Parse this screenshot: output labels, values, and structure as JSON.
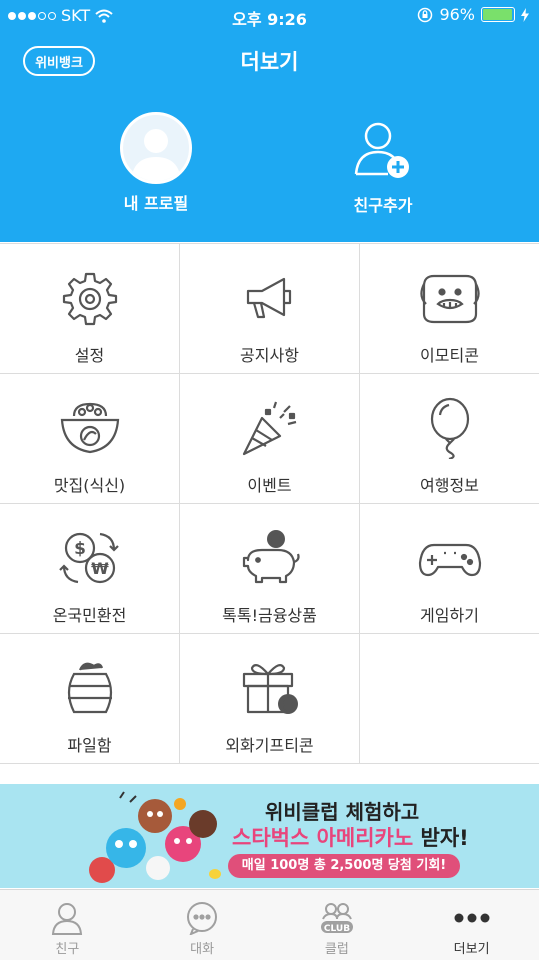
{
  "status": {
    "carrier": "SKT",
    "time": "오후 9:26",
    "battery": "96%",
    "battery_level": 0.96
  },
  "header": {
    "brand": "위비뱅크",
    "title": "더보기",
    "profile_label": "내 프로필",
    "add_friend_label": "친구추가"
  },
  "menu": [
    {
      "label": "설정",
      "icon": "gear-icon"
    },
    {
      "label": "공지사항",
      "icon": "megaphone-icon"
    },
    {
      "label": "이모티콘",
      "icon": "dog-face-icon"
    },
    {
      "label": "맛집(식신)",
      "icon": "bowl-icon"
    },
    {
      "label": "이벤트",
      "icon": "party-popper-icon"
    },
    {
      "label": "여행정보",
      "icon": "balloon-icon"
    },
    {
      "label": "온국민환전",
      "icon": "currency-exchange-icon"
    },
    {
      "label": "톡톡!금융상품",
      "icon": "piggy-bank-icon"
    },
    {
      "label": "게임하기",
      "icon": "gamepad-icon"
    },
    {
      "label": "파일함",
      "icon": "pot-icon"
    },
    {
      "label": "외화기프티콘",
      "icon": "gift-dollar-icon"
    }
  ],
  "banner": {
    "line1": "위비클럽 체험하고",
    "line2_highlight": "스타벅스 아메리카노",
    "line2_rest": " 받자!",
    "line3": "매일 100명 총 2,500명 당첨 기회!"
  },
  "tabs": [
    {
      "label": "친구",
      "icon": "person-icon"
    },
    {
      "label": "대화",
      "icon": "chat-bubble-icon"
    },
    {
      "label": "클럽",
      "icon": "club-icon"
    },
    {
      "label": "더보기",
      "icon": "more-dots-icon"
    }
  ],
  "colors": {
    "header_bg": "#1ea9f2",
    "banner_bg": "#a9e4f1",
    "accent_pink": "#e8457c",
    "icon_stroke": "#555555"
  }
}
